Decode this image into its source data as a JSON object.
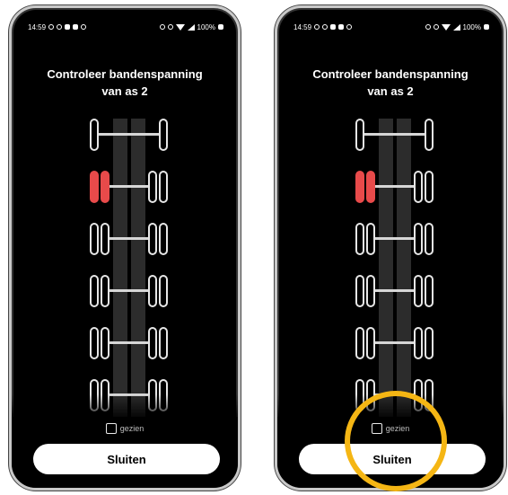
{
  "status_bar": {
    "time": "14:59",
    "battery": "100%"
  },
  "title_line1": "Controleer bandenspanning",
  "title_line2": "van as 2",
  "axles": [
    {
      "type": "single",
      "highlighted": false
    },
    {
      "type": "dual",
      "highlighted": true,
      "highlight_side": "left"
    },
    {
      "type": "dual",
      "highlighted": false
    },
    {
      "type": "dual",
      "highlighted": false
    },
    {
      "type": "dual",
      "highlighted": false
    },
    {
      "type": "dual",
      "highlighted": false
    }
  ],
  "checkbox_label": "gezien",
  "checkbox_checked": false,
  "close_button_label": "Sluiten",
  "colors": {
    "background": "#000000",
    "alert_tire": "#e84a4a",
    "highlight_ring": "#f5b614",
    "button": "#ffffff"
  },
  "annotation": {
    "type": "circle",
    "target": "close-button",
    "screen": "right"
  }
}
